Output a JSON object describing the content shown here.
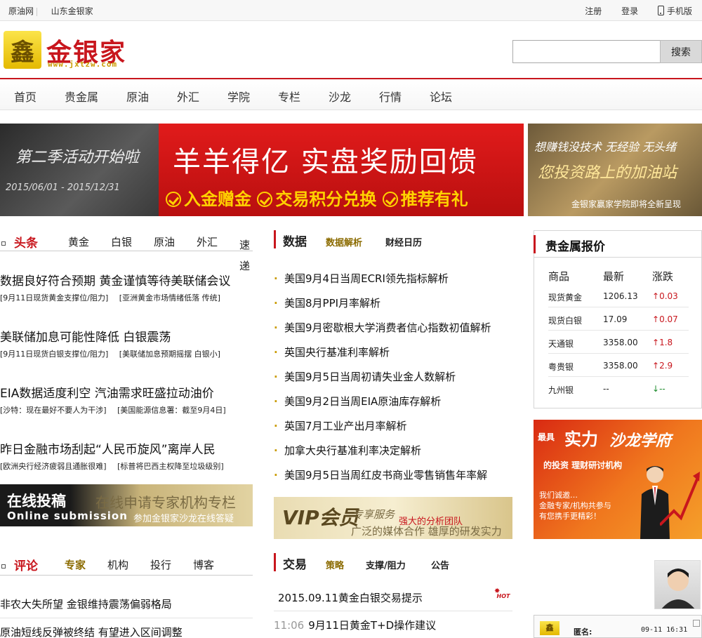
{
  "topbar": {
    "left_links": [
      "原油网",
      "山东金银家"
    ],
    "register": "注册",
    "login": "登录",
    "mobile": "手机版"
  },
  "header": {
    "logo_glyph": "鑫",
    "logo_text": "金银家",
    "logo_url": "www.jxtzw.com",
    "search_placeholder": "",
    "search_button": "搜索"
  },
  "nav": [
    "首页",
    "贵金属",
    "原油",
    "外汇",
    "学院",
    "专栏",
    "沙龙",
    "行情",
    "论坛"
  ],
  "banner_main": {
    "left_title": "第二季活动开始啦",
    "left_dates": "2015/06/01 - 2015/12/31",
    "headline": "羊羊得亿 实盘奖励回馈",
    "items": [
      "入金赠金",
      "交易积分兑换",
      "推荐有礼"
    ]
  },
  "banner_side": {
    "line1": "想赚钱没技术 无经验 无头绪",
    "line2": "您投资路上的加油站",
    "line3": "金银家赢家学院即将全新呈现"
  },
  "headlines": {
    "title": "头条",
    "tabs": [
      "黄金",
      "白银",
      "原油",
      "外汇",
      "速递"
    ],
    "items": [
      {
        "title": "数据良好符合预期 黄金谨慎等待美联储会议",
        "subs": [
          "[9月11日现货黄金支撑位/阻力]",
          "[亚洲黄金市场情绪低落 传统]"
        ]
      },
      {
        "title": "美联储加息可能性降低 白银震荡",
        "subs": [
          "[9月11日现货白银支撑位/阻力]",
          "[美联储加息预期摇摆 白银小]"
        ]
      },
      {
        "title": "EIA数据适度利空 汽油需求旺盛拉动油价",
        "subs": [
          "[沙特：现在最好不要人为干涉]",
          "[美国能源信息署：截至9月4日]"
        ]
      },
      {
        "title": "昨日金融市场刮起“人民币旋风”离岸人民",
        "subs": [
          "[欧洲央行经济疲弱且通胀很难]",
          "[标普将巴西主权降至垃圾级别]"
        ]
      }
    ]
  },
  "promo": {
    "title": "在线投稿",
    "subtitle": "Online submission",
    "right_title": "在线申请专家机构专栏",
    "right_sub": "参加金银家沙龙在线答疑"
  },
  "data_section": {
    "title": "数据",
    "tabs": [
      "数据解析",
      "财经日历"
    ],
    "items": [
      "美国9月4日当周ECRI领先指标解析",
      "美国8月PPI月率解析",
      "美国9月密歇根大学消费者信心指数初值解析",
      "英国央行基准利率解析",
      "美国9月5日当周初请失业金人数解析",
      "美国9月2日当周EIA原油库存解析",
      "英国7月工业产出月率解析",
      "加拿大央行基准利率决定解析",
      "美国9月5日当周红皮书商业零售销售年率解"
    ]
  },
  "vip": {
    "title": "VIP会员",
    "line1": "专享服务",
    "line2": "强大的分析团队",
    "line3": "广泛的媒体合作 雄厚的研发实力"
  },
  "trade_section": {
    "title": "交易",
    "tabs": [
      "策略",
      "支撑/阻力",
      "公告"
    ],
    "items": [
      {
        "time": "",
        "text": "2015.09.11黄金白银交易提示",
        "hot": "HOT"
      },
      {
        "time": "11:06",
        "text": "9月11日黄金T+D操作建议",
        "hot": ""
      }
    ]
  },
  "comment_section": {
    "title": "评论",
    "tabs": [
      "专家",
      "机构",
      "投行",
      "博客"
    ],
    "items": [
      "非农大失所望 金银维持震荡偏弱格局",
      "原油短线反弹被终结 有望进入区间调整"
    ]
  },
  "price_box": {
    "title": "贵金属报价",
    "headers": [
      "商品",
      "最新",
      "涨跌"
    ],
    "rows": [
      {
        "name": "现货黄金",
        "price": "1206.13",
        "change": "0.03",
        "dir": "up"
      },
      {
        "name": "现货白银",
        "price": "17.09",
        "change": "0.07",
        "dir": "up"
      },
      {
        "name": "天通银",
        "price": "3358.00",
        "change": "1.8",
        "dir": "up"
      },
      {
        "name": "粤贵银",
        "price": "3358.00",
        "change": "2.9",
        "dir": "up"
      },
      {
        "name": "九州银",
        "price": "--",
        "change": "--",
        "dir": "down"
      }
    ]
  },
  "salon": {
    "prefix": "最具",
    "title1": "实力",
    "title2": "沙龙学府",
    "tagline": "的投资 理财研讨机构",
    "invite": [
      "我们诚邀…",
      "金融专家/机构共参与",
      "有您携手更精彩！"
    ]
  },
  "chat": {
    "logo": "鑫",
    "name": "匿名:",
    "time": "09-11 16:31"
  }
}
